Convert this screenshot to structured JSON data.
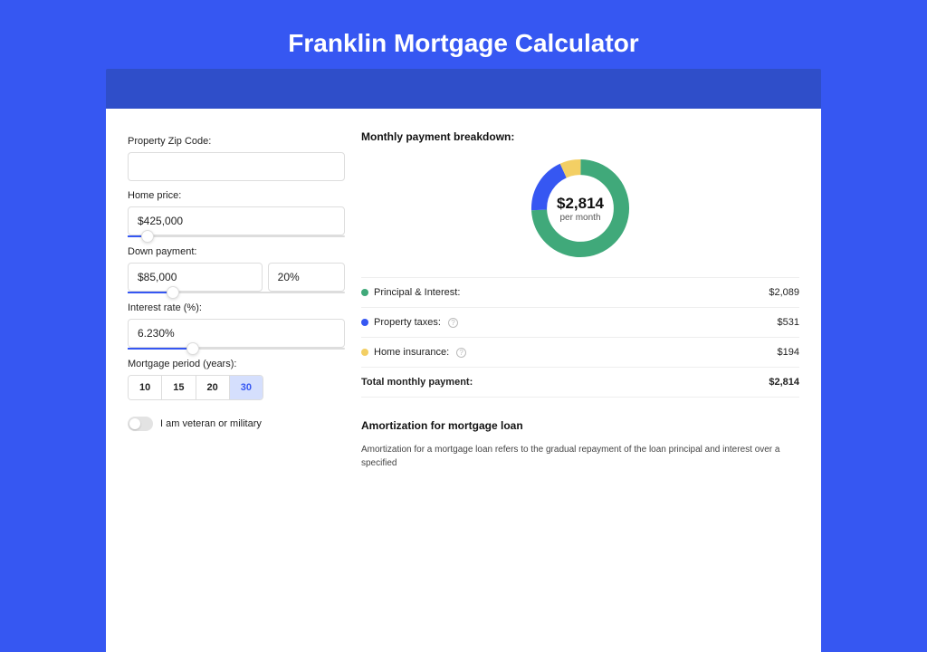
{
  "title": "Franklin Mortgage Calculator",
  "form": {
    "zip": {
      "label": "Property Zip Code:",
      "value": ""
    },
    "home_price": {
      "label": "Home price:",
      "value": "$425,000",
      "slider_pos_pct": 9
    },
    "down_payment": {
      "label": "Down payment:",
      "amount": "$85,000",
      "percent": "20%",
      "slider_pos_pct": 21
    },
    "interest_rate": {
      "label": "Interest rate (%):",
      "value": "6.230%",
      "slider_pos_pct": 30
    },
    "period": {
      "label": "Mortgage period (years):",
      "options": [
        "10",
        "15",
        "20",
        "30"
      ],
      "selected": "30"
    },
    "veteran": {
      "label": "I am veteran or military",
      "on": false
    }
  },
  "breakdown": {
    "title": "Monthly payment breakdown:",
    "center_value": "$2,814",
    "center_sub": "per month",
    "rows": [
      {
        "label": "Principal & Interest:",
        "value": "$2,089",
        "color": "#40a97a",
        "help": false
      },
      {
        "label": "Property taxes:",
        "value": "$531",
        "color": "#3657f2",
        "help": true
      },
      {
        "label": "Home insurance:",
        "value": "$194",
        "color": "#f3cf64",
        "help": true
      }
    ],
    "total": {
      "label": "Total monthly payment:",
      "value": "$2,814"
    }
  },
  "chart_data": {
    "type": "pie",
    "title": "Monthly payment breakdown",
    "series": [
      {
        "name": "Principal & Interest",
        "value": 2089,
        "color": "#40a97a"
      },
      {
        "name": "Property taxes",
        "value": 531,
        "color": "#3657f2"
      },
      {
        "name": "Home insurance",
        "value": 194,
        "color": "#f3cf64"
      }
    ],
    "total": 2814,
    "center_label": "$2,814 per month"
  },
  "amortization": {
    "title": "Amortization for mortgage loan",
    "text": "Amortization for a mortgage loan refers to the gradual repayment of the loan principal and interest over a specified"
  }
}
